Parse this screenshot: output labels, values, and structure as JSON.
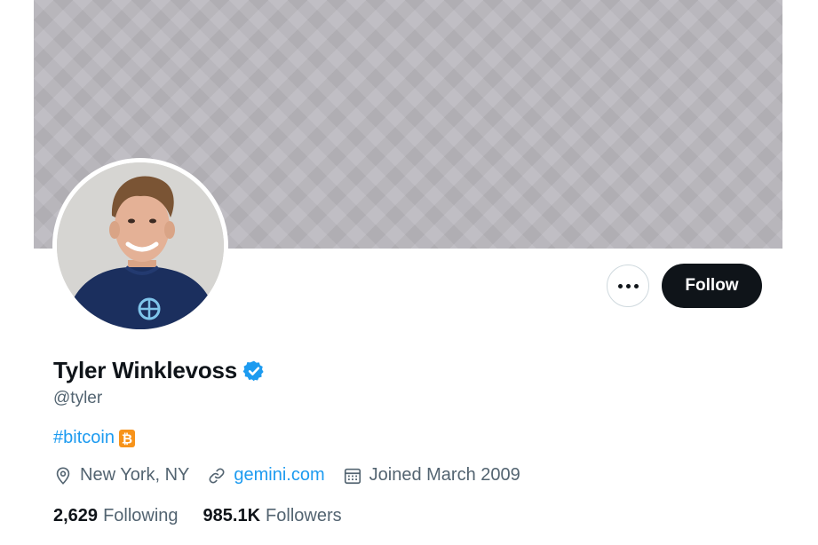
{
  "profile": {
    "name": "Tyler Winklevoss",
    "handle": "@tyler",
    "bio_hashtag": "#bitcoin",
    "location": "New York, NY",
    "website": "gemini.com",
    "joined": "Joined March 2009",
    "following_count": "2,629",
    "following_label": "Following",
    "followers_count": "985.1K",
    "followers_label": "Followers"
  },
  "actions": {
    "follow_label": "Follow",
    "more_icon": "more-horizontal-icon"
  },
  "icons": {
    "verified": "verified-badge-icon",
    "bitcoin": "bitcoin-icon",
    "location": "location-pin-icon",
    "link": "link-icon",
    "calendar": "calendar-icon"
  },
  "colors": {
    "accent": "#1d9bf0",
    "text_primary": "#0f1419",
    "text_secondary": "#536471",
    "banner": "#b9b7bd",
    "bitcoin": "#f7931a"
  }
}
